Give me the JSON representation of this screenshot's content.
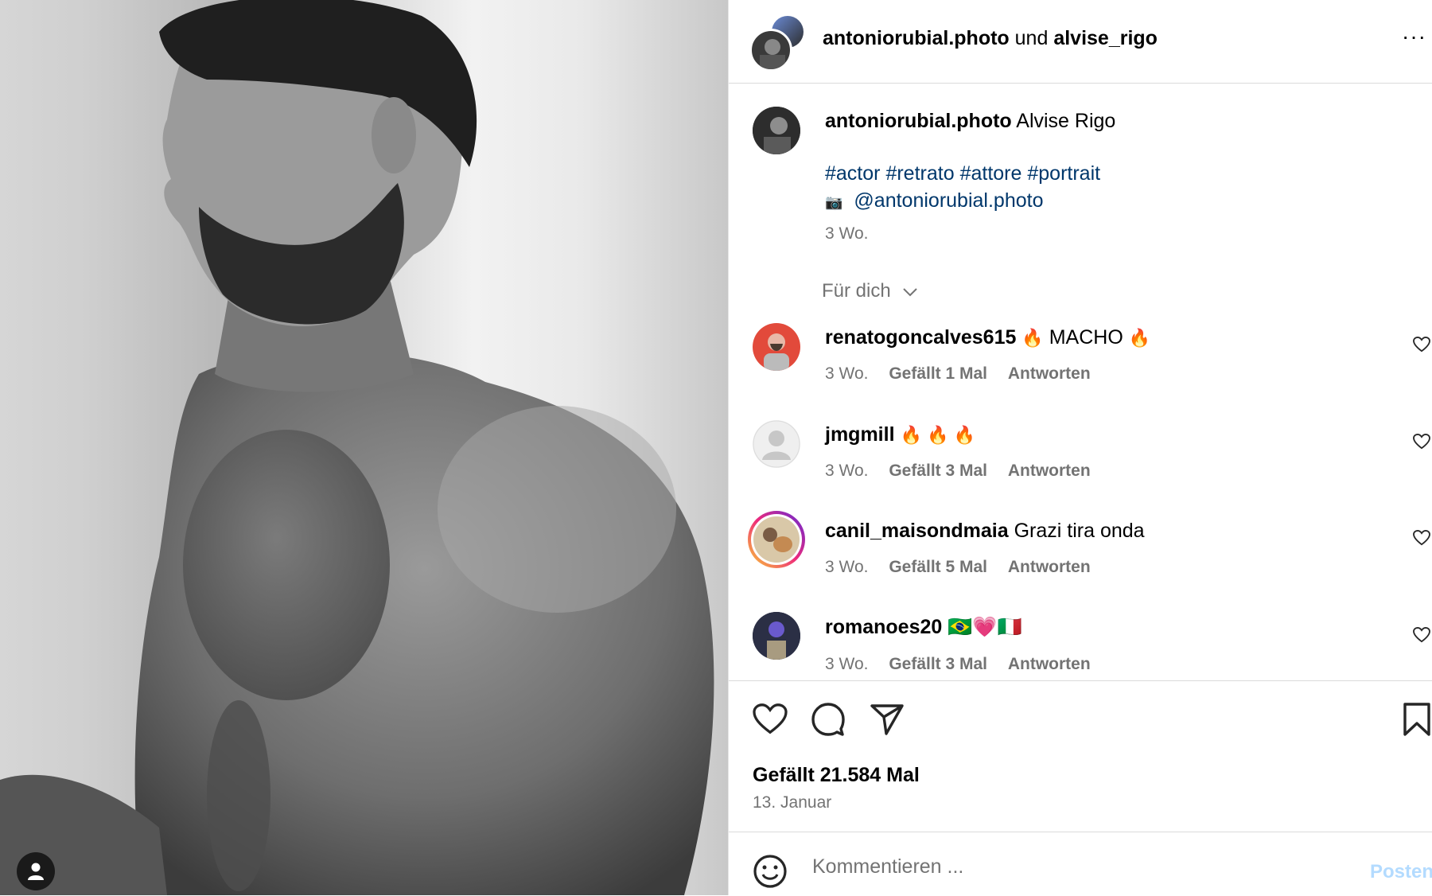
{
  "photo": {
    "alt": "portrait",
    "tag_icon": "person-tag-icon"
  },
  "header": {
    "user1": "antoniorubial.photo",
    "connector": "und",
    "user2": "alvise_rigo",
    "more_icon": "more-horizontal-icon",
    "more_label": "···"
  },
  "caption": {
    "username": "antoniorubial.photo",
    "text": "Alvise Rigo",
    "hashtags": [
      "#actor",
      "#retrato",
      "#attore",
      "#portrait"
    ],
    "camera_icon": "camera-icon",
    "camera_glyph": "📷",
    "mention": "@antoniorubial.photo",
    "time": "3 Wo."
  },
  "filter": {
    "label": "Für dich",
    "icon": "chevron-down-icon"
  },
  "comments": [
    {
      "username": "renatogoncalves615",
      "text": "MACHO",
      "prefix_emoji": "🔥",
      "suffix_emoji": "🔥",
      "time": "3 Wo.",
      "likes": "Gefällt 1 Mal",
      "reply": "Antworten"
    },
    {
      "username": "jmgmill",
      "text": "",
      "suffix_emoji": "🔥 🔥 🔥",
      "time": "3 Wo.",
      "likes": "Gefällt 3 Mal",
      "reply": "Antworten"
    },
    {
      "username": "canil_maisondmaia",
      "text": "Grazi tira onda",
      "time": "3 Wo.",
      "likes": "Gefällt 5 Mal",
      "reply": "Antworten"
    },
    {
      "username": "romanoes20",
      "text": "",
      "suffix_emoji": "🇧🇷💗🇮🇹",
      "time": "3 Wo.",
      "likes": "Gefällt 3 Mal",
      "reply": "Antworten"
    }
  ],
  "actions": {
    "like_icon": "heart-icon",
    "comment_icon": "comment-icon",
    "share_icon": "send-icon",
    "save_icon": "bookmark-icon"
  },
  "likes": "Gefällt 21.584 Mal",
  "date": "13. Januar",
  "comment_bar": {
    "emoji_icon": "smiley-icon",
    "placeholder": "Kommentieren ...",
    "post_label": "Posten"
  },
  "colors": {
    "link": "#00376b",
    "muted": "#737373",
    "post_disabled": "#b3dbff",
    "divider": "#dbdbdb"
  }
}
